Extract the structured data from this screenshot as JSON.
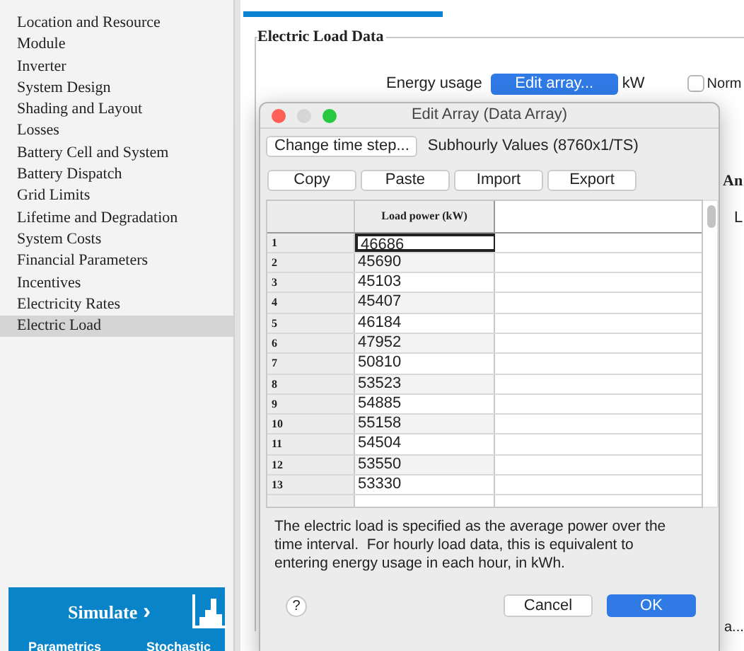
{
  "sidebar": {
    "items": [
      {
        "label": "Location and Resource",
        "selected": false
      },
      {
        "label": "Module",
        "selected": false
      },
      {
        "label": "Inverter",
        "selected": false
      },
      {
        "label": "System Design",
        "selected": false
      },
      {
        "label": "Shading and Layout",
        "selected": false
      },
      {
        "label": "Losses",
        "selected": false
      },
      {
        "label": "Battery Cell and System",
        "selected": false
      },
      {
        "label": "Battery Dispatch",
        "selected": false
      },
      {
        "label": "Grid Limits",
        "selected": false
      },
      {
        "label": "Lifetime and Degradation",
        "selected": false
      },
      {
        "label": "System Costs",
        "selected": false
      },
      {
        "label": "Financial Parameters",
        "selected": false
      },
      {
        "label": "Incentives",
        "selected": false
      },
      {
        "label": "Electricity Rates",
        "selected": false
      },
      {
        "label": "Electric Load",
        "selected": true
      }
    ],
    "simulate": {
      "label": "Simulate",
      "chevron": "›",
      "links": [
        "Parametrics",
        "Stochastic"
      ]
    }
  },
  "main": {
    "group_title": "Electric Load Data",
    "energy_usage": {
      "label": "Energy usage",
      "button": "Edit array...",
      "unit": "kW"
    },
    "normalize": {
      "label": "Norm",
      "checked": false
    },
    "side_texts": [
      "An",
      "L"
    ],
    "bottom_text": "a..."
  },
  "dialog": {
    "title": "Edit Array (Data Array)",
    "time_step_button": "Change time step...",
    "time_step_info": "Subhourly Values (8760x1/TS)",
    "buttons": [
      "Copy",
      "Paste",
      "Import",
      "Export"
    ],
    "table": {
      "header": "Load power (kW)",
      "rows": [
        {
          "index": "1",
          "value": "46686",
          "selected": true
        },
        {
          "index": "2",
          "value": "45690",
          "selected": false
        },
        {
          "index": "3",
          "value": "45103",
          "selected": false
        },
        {
          "index": "4",
          "value": "45407",
          "selected": false
        },
        {
          "index": "5",
          "value": "46184",
          "selected": false
        },
        {
          "index": "6",
          "value": "47952",
          "selected": false
        },
        {
          "index": "7",
          "value": "50810",
          "selected": false
        },
        {
          "index": "8",
          "value": "53523",
          "selected": false
        },
        {
          "index": "9",
          "value": "54885",
          "selected": false
        },
        {
          "index": "10",
          "value": "55158",
          "selected": false
        },
        {
          "index": "11",
          "value": "54504",
          "selected": false
        },
        {
          "index": "12",
          "value": "53550",
          "selected": false
        },
        {
          "index": "13",
          "value": "53330",
          "selected": false
        }
      ]
    },
    "note": "The electric load is specified as the average power over the time interval.  For hourly load data, this is equivalent to entering energy usage in each hour, in kWh.",
    "help": "?",
    "cancel": "Cancel",
    "ok": "OK"
  }
}
